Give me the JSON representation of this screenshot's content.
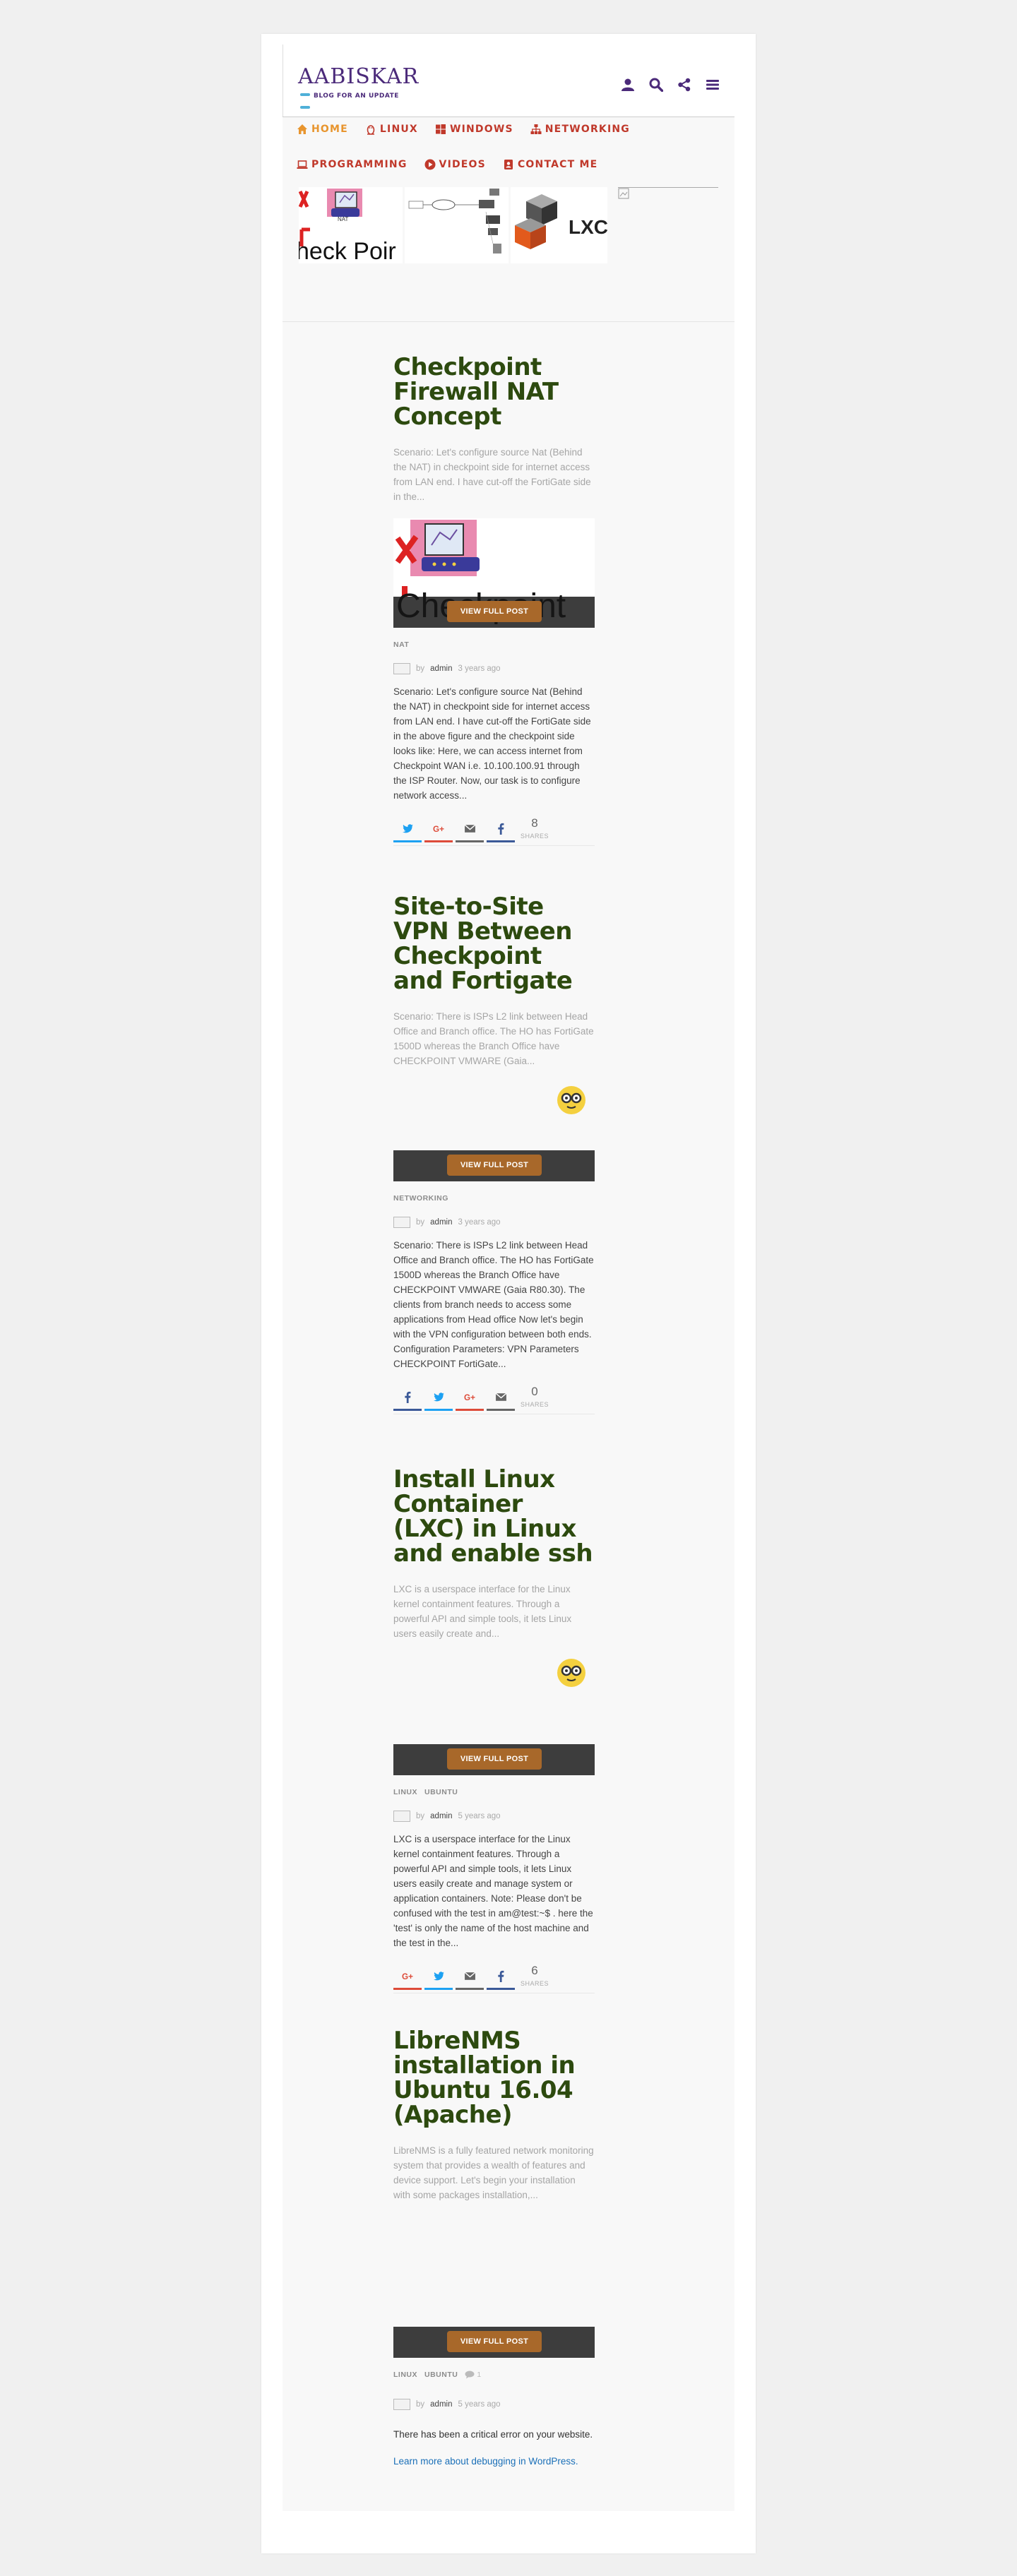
{
  "site": {
    "brand": "AABISKAR",
    "tagline": "BLOG FOR AN UPDATE"
  },
  "header_icons": [
    "user-icon",
    "search-icon",
    "share-icon",
    "menu-icon"
  ],
  "nav": {
    "row1": [
      {
        "label": "HOME",
        "icon": "home-icon",
        "active": true
      },
      {
        "label": "LINUX",
        "icon": "linux-icon"
      },
      {
        "label": "WINDOWS",
        "icon": "windows-icon"
      },
      {
        "label": "NETWORKING",
        "icon": "network-icon"
      }
    ],
    "row2": [
      {
        "label": "PROGRAMMING",
        "icon": "laptop-icon"
      },
      {
        "label": "VIDEOS",
        "icon": "play-icon"
      },
      {
        "label": "CONTACT ME",
        "icon": "contact-icon"
      }
    ]
  },
  "featured": {
    "thumb1_text": "heck Poir",
    "thumb3_text": "LXC"
  },
  "colors": {
    "title": "#2d4a0f",
    "nav": "#c0392b",
    "nav_active": "#e8952e",
    "button": "#a8682a",
    "bar": "#3d3d3d"
  },
  "view_full_post": "VIEW FULL POST",
  "shares_label": "SHARES",
  "by_label": "by",
  "posts": [
    {
      "title": "Checkpoint Firewall NAT Concept",
      "excerpt": "Scenario: Let's configure source Nat (Behind the NAT) in checkpoint side for internet access from LAN end. I have cut-off the FortiGate side in the...",
      "image_text": "Checkpoint",
      "categories": [
        "NAT"
      ],
      "author": "admin",
      "time": "3 years ago",
      "body": "Scenario: Let's configure source Nat (Behind the NAT) in checkpoint side for internet access from LAN end. I have cut-off the FortiGate side in the above figure and the checkpoint side looks like: Here, we can access internet from Checkpoint WAN i.e. 10.100.100.91 through the ISP Router. Now, our task is to configure network access...",
      "shares": "8",
      "share_buttons": [
        "twitter-icon",
        "google-plus-icon",
        "email-icon",
        "facebook-icon"
      ]
    },
    {
      "title": "Site-to-Site VPN Between Checkpoint and Fortigate",
      "excerpt": "Scenario: There is ISPs L2 link between Head Office and Branch office. The HO has FortiGate 1500D whereas the Branch Office have CHECKPOINT VMWARE (Gaia...",
      "categories": [
        "NETWORKING"
      ],
      "author": "admin",
      "time": "3 years ago",
      "body": "Scenario: There is ISPs L2 link between Head Office and Branch office. The HO has FortiGate 1500D whereas the Branch Office have CHECKPOINT VMWARE (Gaia R80.30). The clients from branch needs to access some applications from Head office Now let's begin with the VPN configuration between both ends. Configuration Parameters:   VPN Parameters CHECKPOINT FortiGate...",
      "shares": "0",
      "share_buttons": [
        "facebook-icon",
        "twitter-icon",
        "google-plus-icon",
        "email-icon"
      ]
    },
    {
      "title": "Install Linux Container (LXC) in Linux and enable ssh",
      "excerpt": "LXC is a userspace interface for the Linux kernel containment features. Through a powerful API and simple tools, it lets Linux users easily create and...",
      "categories": [
        "LINUX",
        "UBUNTU"
      ],
      "author": "admin",
      "time": "5 years ago",
      "body": "LXC is a userspace interface for the Linux kernel containment features. Through a powerful API and simple tools, it lets Linux users easily create and manage system or application containers. Note: Please don't be confused with the test in am@test:~$ . here the 'test' is only the name of the host machine and the test in the...",
      "shares": "6",
      "share_buttons": [
        "google-plus-icon",
        "twitter-icon",
        "email-icon",
        "facebook-icon"
      ]
    },
    {
      "title": "LibreNMS installation in Ubuntu 16.04 (Apache)",
      "excerpt": "LibreNMS is a fully featured network monitoring system that provides a wealth of features and device support. Let's begin your installation with some packages installation,...",
      "categories": [
        "LINUX",
        "UBUNTU"
      ],
      "comments": "1",
      "author": "admin",
      "time": "5 years ago",
      "error": "There has been a critical error on your website.",
      "error_link": "Learn more about debugging in WordPress."
    }
  ]
}
